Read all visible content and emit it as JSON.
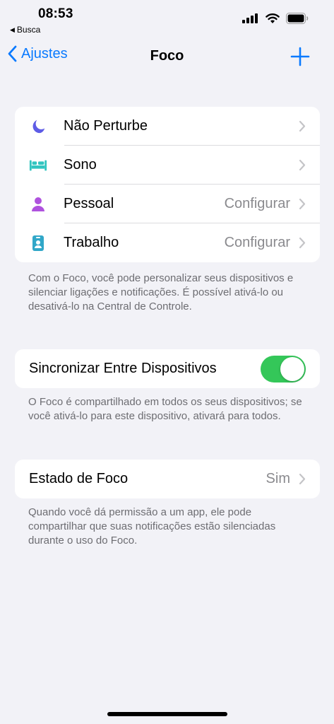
{
  "status_bar": {
    "time": "08:53",
    "back_app": "Busca",
    "icons": [
      "cellular-signal-icon",
      "wifi-icon",
      "battery-icon"
    ]
  },
  "nav": {
    "back_label": "Ajustes",
    "title": "Foco",
    "add_icon": "plus-icon"
  },
  "focus_modes": [
    {
      "label": "Não Perturbe",
      "value": "",
      "icon": "moon-icon",
      "color": "#5e5ce6"
    },
    {
      "label": "Sono",
      "value": "",
      "icon": "bed-icon",
      "color": "#30c5c0"
    },
    {
      "label": "Pessoal",
      "value": "Configurar",
      "icon": "person-icon",
      "color": "#af52de"
    },
    {
      "label": "Trabalho",
      "value": "Configurar",
      "icon": "id-badge-icon",
      "color": "#31a7c8"
    }
  ],
  "focus_footer": "Com o Foco, você pode personalizar seus dispositivos e silenciar ligações e notificações. É possível ativá-lo ou desativá-lo na Central de Controle.",
  "sync": {
    "label": "Sincronizar Entre Dispositivos",
    "enabled": true,
    "footer": "O Foco é compartilhado em todos os seus dispositivos; se você ativá-lo para este dispositivo, ativará para todos."
  },
  "focus_status": {
    "label": "Estado de Foco",
    "value": "Sim",
    "footer": "Quando você dá permissão a um app, ele pode compartilhar que suas notificações estão silenciadas durante o uso do Foco."
  },
  "colors": {
    "accent": "#0a7aff",
    "toggle_on": "#34c759",
    "background": "#f2f2f7",
    "secondary_text": "#8a8a8e"
  }
}
